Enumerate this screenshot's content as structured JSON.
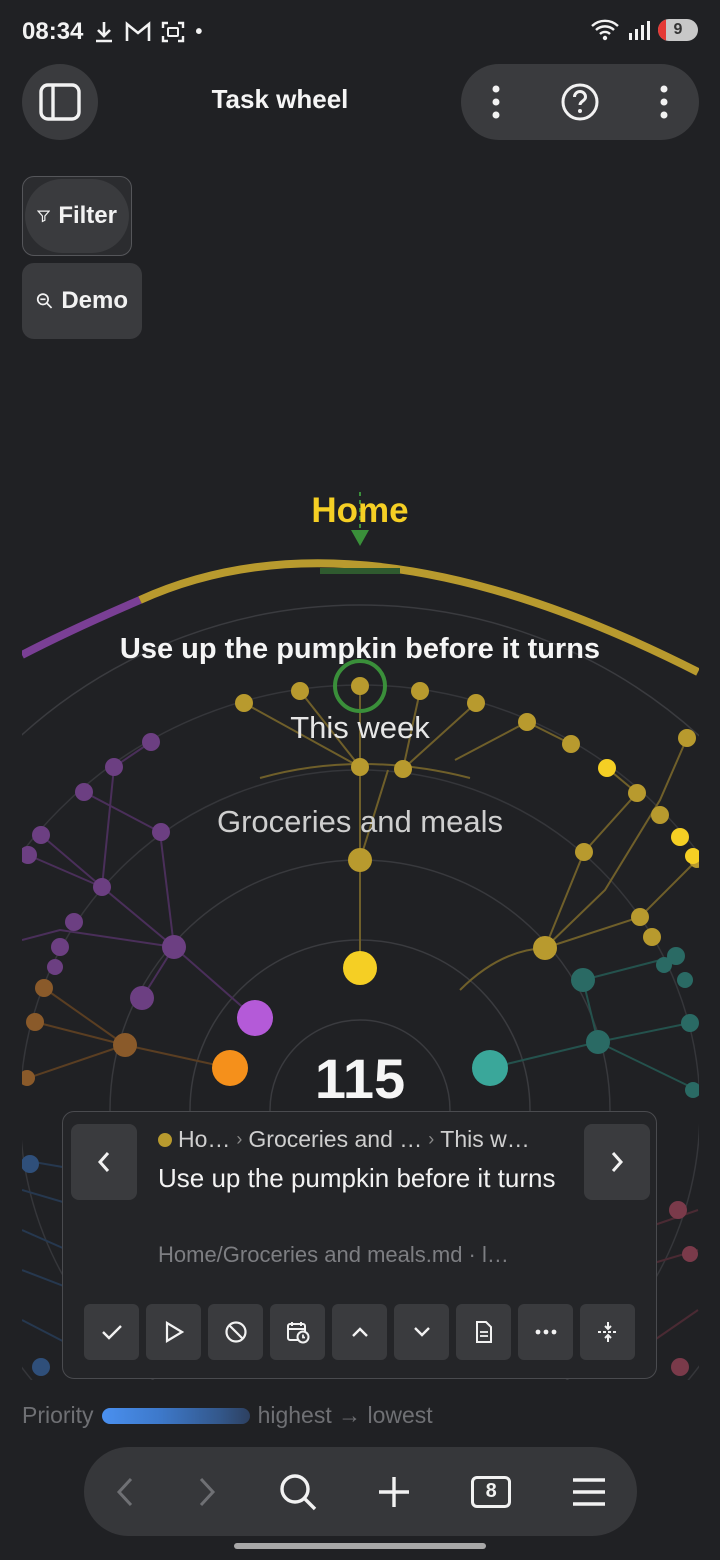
{
  "status_bar": {
    "time": "08:34",
    "battery": "9"
  },
  "header": {
    "title": "Task wheel"
  },
  "toolbar": {
    "filter_label": "Filter",
    "demo_label": "Demo"
  },
  "wheel": {
    "segment_label": "Home",
    "task_label": "Use up the pumpkin before it turns",
    "level1_label": "This week",
    "level2_label": "Groceries and meals",
    "center_count": "115",
    "colors": {
      "home": "#b89a2e",
      "highlight": "#f5cf24",
      "purple": "#8a4bb0",
      "teal": "#3aa79a",
      "orange": "#f5901b",
      "selection": "#3a8f3a"
    }
  },
  "task_card": {
    "breadcrumb": [
      "Ho…",
      "Groceries and …",
      "This w…"
    ],
    "title": "Use up the pumpkin before it turns",
    "path": "Home/Groceries and meals.md · l…"
  },
  "legend": {
    "label": "Priority",
    "range": "highest → lowest"
  },
  "browser_nav": {
    "tabs_count": "8"
  }
}
